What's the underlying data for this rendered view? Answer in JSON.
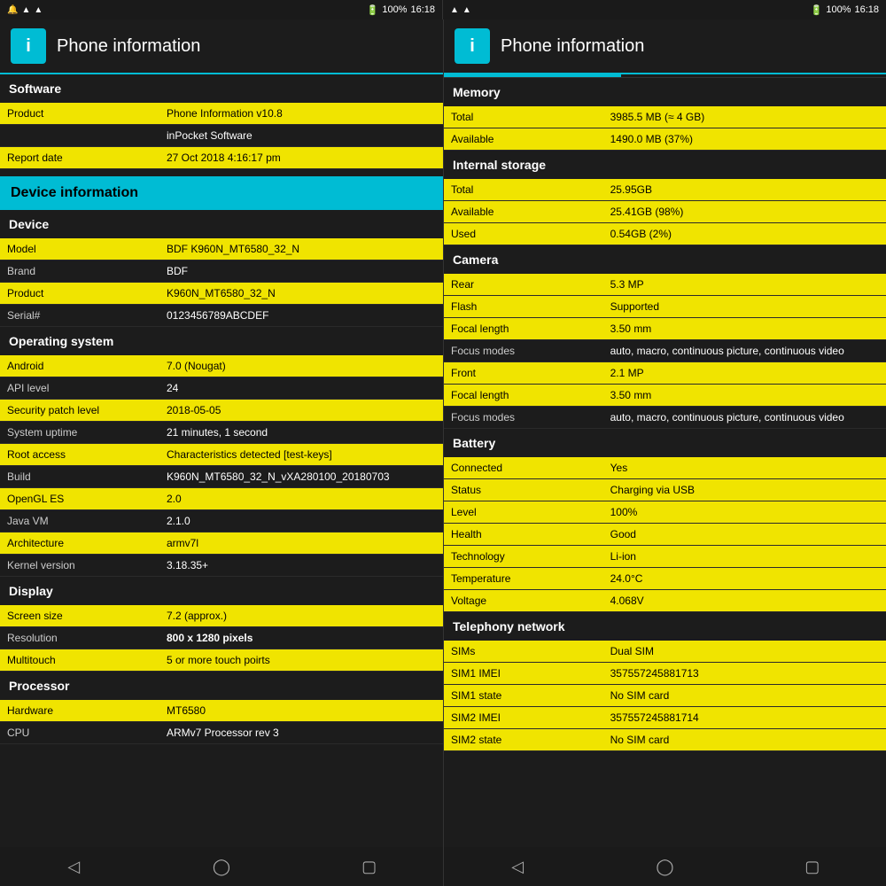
{
  "statusBar": {
    "left": {
      "icons": [
        "notification",
        "wifi",
        "signal",
        "signal2"
      ]
    },
    "right": {
      "battery": "100%",
      "time": "16:18"
    }
  },
  "leftPanel": {
    "appTitle": "Phone information",
    "tabs": [
      "Software",
      "Device",
      "OS",
      "Display",
      "Processor"
    ],
    "activeTab": "Software",
    "sections": {
      "software": {
        "header": "Software",
        "rows": [
          {
            "label": "Product",
            "value": "Phone Information v10.8"
          },
          {
            "label": "",
            "value": "inPocket Software"
          },
          {
            "label": "Report date",
            "value": "27 Oct 2018 4:16:17 pm"
          }
        ]
      },
      "deviceBanner": "Device information",
      "device": {
        "header": "Device",
        "rows": [
          {
            "label": "Model",
            "value": "BDF K960N_MT6580_32_N"
          },
          {
            "label": "Brand",
            "value": "BDF"
          },
          {
            "label": "Product",
            "value": "K960N_MT6580_32_N"
          },
          {
            "label": "Serial#",
            "value": "0123456789ABCDEF"
          }
        ]
      },
      "os": {
        "header": "Operating system",
        "rows": [
          {
            "label": "Android",
            "value": "7.0 (Nougat)",
            "valueClass": ""
          },
          {
            "label": "API level",
            "value": "24",
            "valueClass": ""
          },
          {
            "label": "Security patch level",
            "value": "2018-05-05",
            "valueClass": ""
          },
          {
            "label": "System uptime",
            "value": "21 minutes, 1 second",
            "valueClass": "val-red"
          },
          {
            "label": "Root access",
            "value": "Characteristics detected [test-keys]",
            "valueClass": ""
          },
          {
            "label": "Build",
            "value": "K960N_MT6580_32_N_vXA280100_20180703",
            "valueClass": ""
          },
          {
            "label": "OpenGL ES",
            "value": "2.0",
            "valueClass": ""
          },
          {
            "label": "Java VM",
            "value": "2.1.0",
            "valueClass": ""
          },
          {
            "label": "Architecture",
            "value": "armv7l",
            "valueClass": ""
          },
          {
            "label": "Kernel version",
            "value": "3.18.35+",
            "valueClass": ""
          }
        ]
      },
      "display": {
        "header": "Display",
        "rows": [
          {
            "label": "Screen size",
            "value": "7.2 (approx.)",
            "valueClass": ""
          },
          {
            "label": "Resolution",
            "value": "800 x 1280 pixels",
            "valueClass": ""
          },
          {
            "label": "Multitouch",
            "value": "5 or more touch poirts",
            "valueClass": ""
          }
        ]
      },
      "processor": {
        "header": "Processor",
        "rows": [
          {
            "label": "Hardware",
            "value": "MT6580",
            "valueClass": ""
          },
          {
            "label": "CPU",
            "value": "ARMv7 Processor rev 3",
            "valueClass": ""
          }
        ]
      }
    }
  },
  "rightPanel": {
    "appTitle": "Phone information",
    "memory": {
      "header": "Memory",
      "rows": [
        {
          "label": "Total",
          "value": "3985.5 MB (≈ 4 GB)",
          "valueClass": ""
        },
        {
          "label": "Available",
          "value": "1490.0 MB (37%)",
          "valueClass": ""
        }
      ]
    },
    "internalStorage": {
      "header": "Internal storage",
      "rows": [
        {
          "label": "Total",
          "value": "25.95GB",
          "valueClass": ""
        },
        {
          "label": "Available",
          "value": "25.41GB (98%)",
          "valueClass": ""
        },
        {
          "label": "Used",
          "value": "0.54GB (2%)",
          "valueClass": ""
        }
      ]
    },
    "camera": {
      "header": "Camera",
      "rear": {
        "subheader": "Rear",
        "rows": [
          {
            "label": "Rear",
            "value": "5.3 MP",
            "valueClass": ""
          },
          {
            "label": "Flash",
            "value": "Supported",
            "valueClass": ""
          },
          {
            "label": "Focal length",
            "value": "3.50 mm",
            "valueClass": ""
          },
          {
            "label": "Focus modes",
            "value": "auto, macro, continuous picture, continuous video",
            "valueClass": ""
          }
        ]
      },
      "front": {
        "rows": [
          {
            "label": "Front",
            "value": "2.1 MP",
            "valueClass": ""
          },
          {
            "label": "Focal length",
            "value": "3.50 mm",
            "valueClass": ""
          },
          {
            "label": "Focus modes",
            "value": "auto, macro, continuous picture, continuous video",
            "valueClass": ""
          }
        ]
      }
    },
    "battery": {
      "header": "Battery",
      "rows": [
        {
          "label": "Connected",
          "value": "Yes",
          "valueClass": ""
        },
        {
          "label": "Status",
          "value": "Charging via USB",
          "valueClass": "val-green"
        },
        {
          "label": "Level",
          "value": "100%",
          "valueClass": "val-green"
        },
        {
          "label": "Health",
          "value": "Good",
          "valueClass": "val-green"
        },
        {
          "label": "Technology",
          "value": "Li-ion",
          "valueClass": ""
        },
        {
          "label": "Temperature",
          "value": "24.0°C",
          "valueClass": "val-orange"
        },
        {
          "label": "Voltage",
          "value": "4.068V",
          "valueClass": ""
        }
      ]
    },
    "telephony": {
      "header": "Telephony network",
      "rows": [
        {
          "label": "SIMs",
          "value": "Dual SIM",
          "valueClass": ""
        },
        {
          "label": "SIM1 IMEI",
          "value": "357557245881713",
          "valueClass": ""
        },
        {
          "label": "SIM1 state",
          "value": "No SIM card",
          "valueClass": "val-red"
        },
        {
          "label": "SIM2 IMEI",
          "value": "357557245881714",
          "valueClass": ""
        },
        {
          "label": "SIM2 state",
          "value": "No SIM card",
          "valueClass": "val-red"
        }
      ]
    }
  },
  "bottomNav": {
    "buttons": [
      "back",
      "home",
      "recents"
    ]
  }
}
